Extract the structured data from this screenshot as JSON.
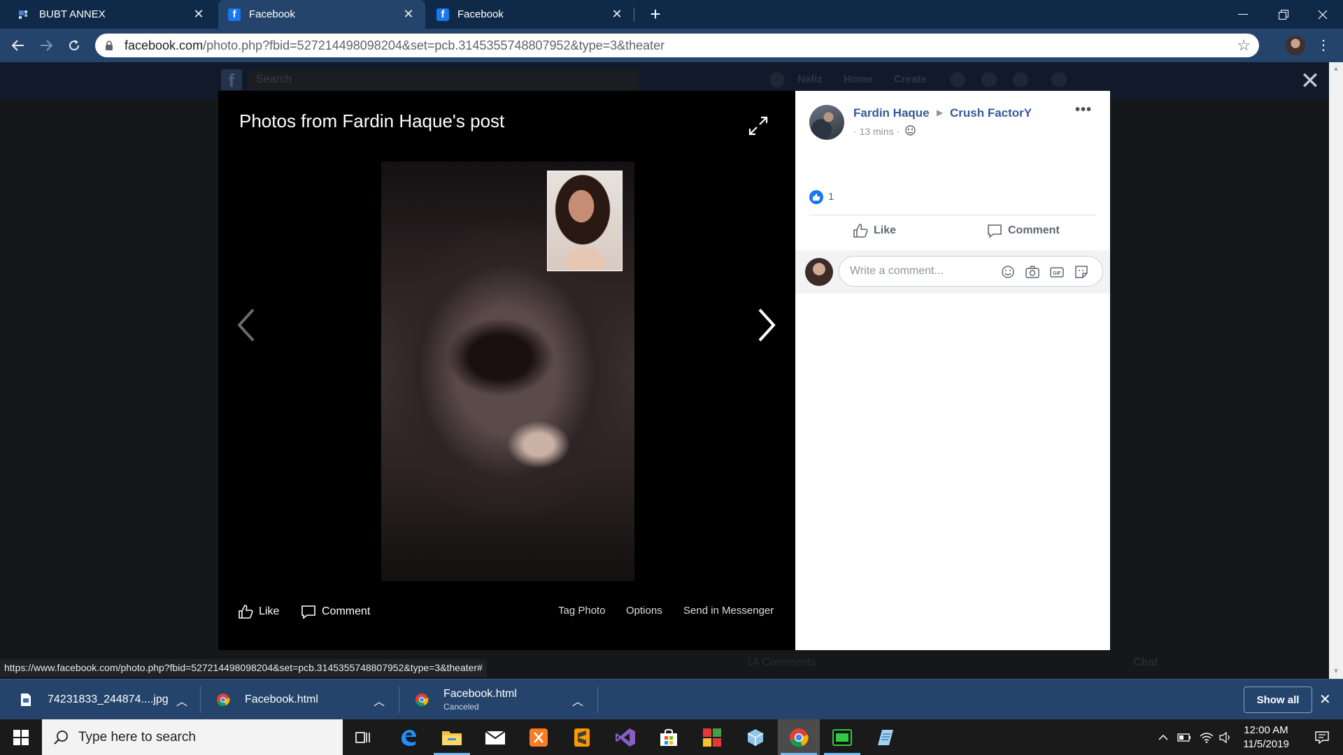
{
  "browser": {
    "tabs": [
      {
        "title": "BUBT ANNEX",
        "active": false
      },
      {
        "title": "Facebook",
        "active": true
      },
      {
        "title": "Facebook",
        "active": false
      }
    ],
    "new_tab": "+",
    "url_host": "facebook.com",
    "url_path": "/photo.php?fbid=527214498098204&set=pcb.3145355748807952&type=3&theater",
    "status_url": "https://www.facebook.com/photo.php?fbid=527214498098204&set=pcb.3145355748807952&type=3&theater#"
  },
  "background_page": {
    "search_placeholder": "Search",
    "nav": [
      "Nafiz",
      "Home",
      "Create"
    ],
    "ghost_comments": "14 Comments",
    "chat_label": "Chat"
  },
  "viewer": {
    "title": "Photos from Fardin Haque's post",
    "like": "Like",
    "comment": "Comment",
    "tag_photo": "Tag Photo",
    "options": "Options",
    "send_in_messenger": "Send in Messenger"
  },
  "post": {
    "author": "Fardin Haque",
    "group": "Crush FactorY",
    "time": "13 mins",
    "reaction_count": "1",
    "like": "Like",
    "comment": "Comment",
    "comment_placeholder": "Write a comment..."
  },
  "downloads": [
    {
      "name": "74231833_244874....jpg",
      "sub": ""
    },
    {
      "name": "Facebook.html",
      "sub": ""
    },
    {
      "name": "Facebook.html",
      "sub": "Canceled"
    }
  ],
  "downloads_show_all": "Show all",
  "taskbar": {
    "search_placeholder": "Type here to search",
    "time": "12:00 AM",
    "date": "11/5/2019"
  },
  "colors": {
    "tab_strip": "#0f2a48",
    "toolbar": "#24446b",
    "facebook_link": "#385898",
    "facebook_blue": "#1877f2"
  }
}
